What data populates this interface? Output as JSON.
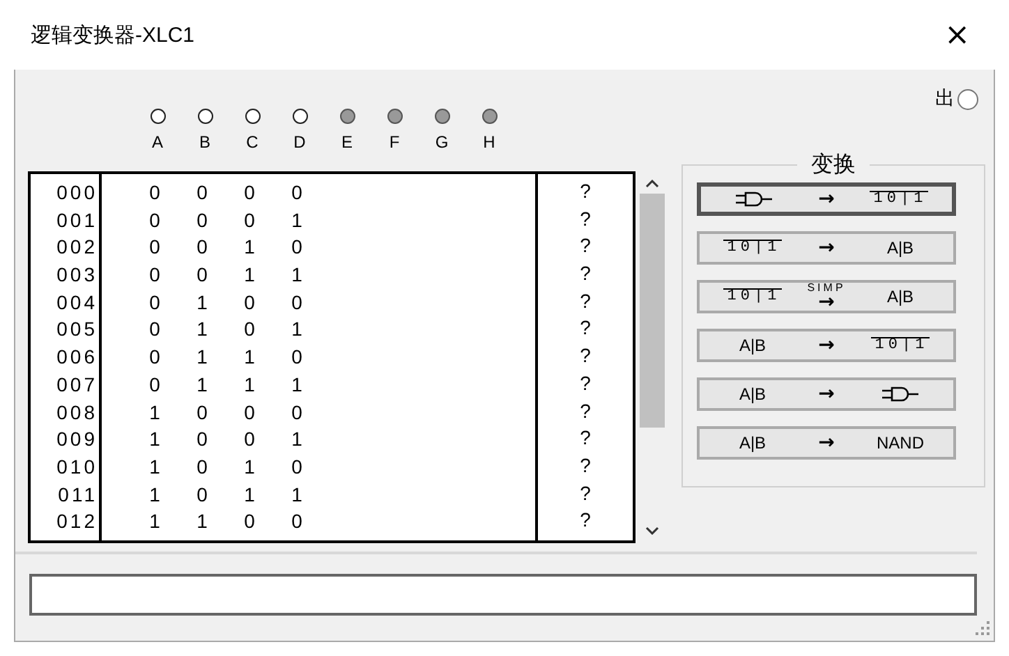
{
  "window": {
    "title": "逻辑变换器-XLC1",
    "close": "×"
  },
  "output": {
    "label": "出"
  },
  "inputs": [
    {
      "label": "A",
      "active": true
    },
    {
      "label": "B",
      "active": true
    },
    {
      "label": "C",
      "active": true
    },
    {
      "label": "D",
      "active": true
    },
    {
      "label": "E",
      "active": false
    },
    {
      "label": "F",
      "active": false
    },
    {
      "label": "G",
      "active": false
    },
    {
      "label": "H",
      "active": false
    }
  ],
  "truth_table": {
    "rows": [
      {
        "index": "000",
        "bits": [
          "0",
          "0",
          "0",
          "0"
        ],
        "output": "?"
      },
      {
        "index": "001",
        "bits": [
          "0",
          "0",
          "0",
          "1"
        ],
        "output": "?"
      },
      {
        "index": "002",
        "bits": [
          "0",
          "0",
          "1",
          "0"
        ],
        "output": "?"
      },
      {
        "index": "003",
        "bits": [
          "0",
          "0",
          "1",
          "1"
        ],
        "output": "?"
      },
      {
        "index": "004",
        "bits": [
          "0",
          "1",
          "0",
          "0"
        ],
        "output": "?"
      },
      {
        "index": "005",
        "bits": [
          "0",
          "1",
          "0",
          "1"
        ],
        "output": "?"
      },
      {
        "index": "006",
        "bits": [
          "0",
          "1",
          "1",
          "0"
        ],
        "output": "?"
      },
      {
        "index": "007",
        "bits": [
          "0",
          "1",
          "1",
          "1"
        ],
        "output": "?"
      },
      {
        "index": "008",
        "bits": [
          "1",
          "0",
          "0",
          "0"
        ],
        "output": "?"
      },
      {
        "index": "009",
        "bits": [
          "1",
          "0",
          "0",
          "1"
        ],
        "output": "?"
      },
      {
        "index": "010",
        "bits": [
          "1",
          "0",
          "1",
          "0"
        ],
        "output": "?"
      },
      {
        "index": "011",
        "bits": [
          "1",
          "0",
          "1",
          "1"
        ],
        "output": "?"
      },
      {
        "index": "012",
        "bits": [
          "1",
          "1",
          "0",
          "0"
        ],
        "output": "?"
      }
    ]
  },
  "conversions": {
    "title": "变换",
    "buttons": [
      {
        "selected": true,
        "from": {
          "kind": "gate"
        },
        "arrow": "→",
        "to": {
          "kind": "table",
          "text": "10|1"
        }
      },
      {
        "selected": false,
        "from": {
          "kind": "table",
          "text": "10|1"
        },
        "arrow": "→",
        "to": {
          "kind": "expression",
          "text": "A|B"
        }
      },
      {
        "selected": false,
        "from": {
          "kind": "table",
          "text": "10|1"
        },
        "arrow": "→",
        "arrow_label": "SIMP",
        "to": {
          "kind": "expression",
          "text": "A|B"
        }
      },
      {
        "selected": false,
        "from": {
          "kind": "expression",
          "text": "A|B"
        },
        "arrow": "→",
        "to": {
          "kind": "table",
          "text": "10|1"
        }
      },
      {
        "selected": false,
        "from": {
          "kind": "expression",
          "text": "A|B"
        },
        "arrow": "→",
        "to": {
          "kind": "gate"
        }
      },
      {
        "selected": false,
        "from": {
          "kind": "expression",
          "text": "A|B"
        },
        "arrow": "→",
        "to": {
          "kind": "text",
          "text": "NAND"
        }
      }
    ]
  }
}
